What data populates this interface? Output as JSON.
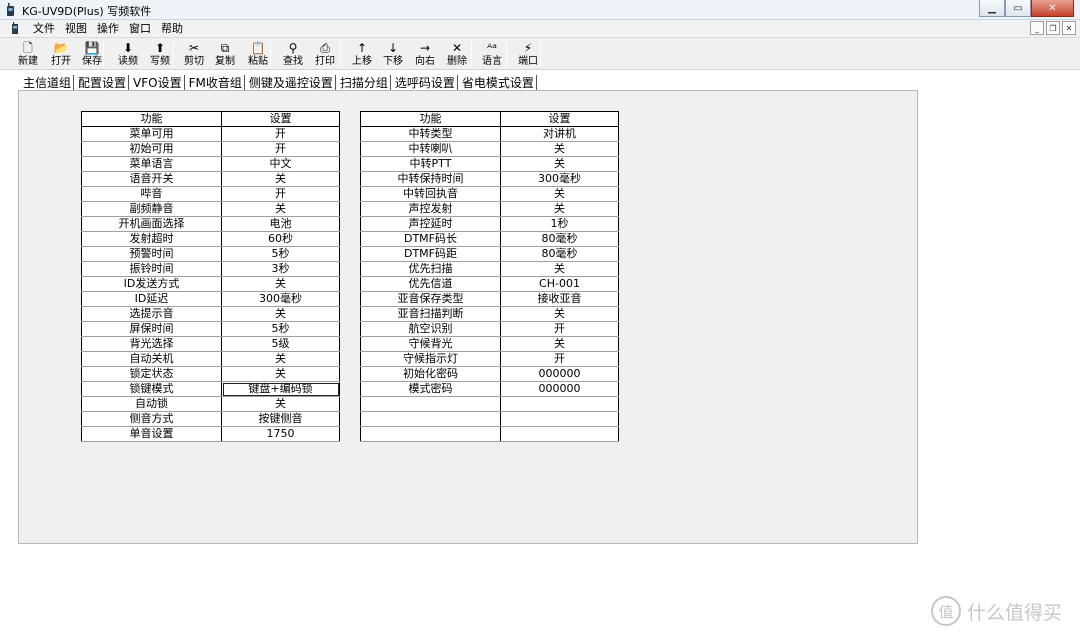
{
  "window": {
    "title": "KG-UV9D(Plus) 写频软件"
  },
  "menu": [
    "文件",
    "视图",
    "操作",
    "窗口",
    "帮助"
  ],
  "toolbar": [
    {
      "label": "新建",
      "icon": "new-file-icon",
      "glyph": "🗋"
    },
    {
      "label": "打开",
      "icon": "open-folder-icon",
      "glyph": "📂"
    },
    {
      "label": "保存",
      "icon": "save-disk-icon",
      "glyph": "💾"
    },
    {
      "label": "读频",
      "icon": "arrow-down-icon",
      "glyph": "⬇"
    },
    {
      "label": "写频",
      "icon": "arrow-up-icon",
      "glyph": "⬆"
    },
    {
      "label": "剪切",
      "icon": "scissors-icon",
      "glyph": "✂"
    },
    {
      "label": "复制",
      "icon": "copy-icon",
      "glyph": "⧉"
    },
    {
      "label": "粘贴",
      "icon": "paste-icon",
      "glyph": "📋"
    },
    {
      "label": "查找",
      "icon": "binoculars-icon",
      "glyph": "⚲"
    },
    {
      "label": "打印",
      "icon": "printer-icon",
      "glyph": "⎙"
    },
    {
      "label": "上移",
      "icon": "move-up-icon",
      "glyph": "↑"
    },
    {
      "label": "下移",
      "icon": "move-down-icon",
      "glyph": "↓"
    },
    {
      "label": "向右",
      "icon": "move-right-icon",
      "glyph": "→"
    },
    {
      "label": "删除",
      "icon": "delete-x-icon",
      "glyph": "✕"
    },
    {
      "label": "语言",
      "icon": "language-icon",
      "glyph": "ᴬᵃ"
    },
    {
      "label": "端口",
      "icon": "port-icon",
      "glyph": "⚡"
    }
  ],
  "tabs": [
    "主信道组",
    "配置设置",
    "VFO设置",
    "FM收音组",
    "侧键及遥控设置",
    "扫描分组",
    "选呼码设置",
    "省电模式设置"
  ],
  "active_tab": "配置设置",
  "table_header": {
    "function": "功能",
    "setting": "设置"
  },
  "left_table": [
    [
      "菜单可用",
      "开"
    ],
    [
      "初始可用",
      "开"
    ],
    [
      "菜单语言",
      "中文"
    ],
    [
      "语音开关",
      "关"
    ],
    [
      "哔音",
      "开"
    ],
    [
      "副频静音",
      "关"
    ],
    [
      "开机画面选择",
      "电池"
    ],
    [
      "发射超时",
      "60秒"
    ],
    [
      "预警时间",
      "5秒"
    ],
    [
      "振铃时间",
      "3秒"
    ],
    [
      "ID发送方式",
      "关"
    ],
    [
      "ID延迟",
      "300毫秒"
    ],
    [
      "选提示音",
      "关"
    ],
    [
      "屏保时间",
      "5秒"
    ],
    [
      "背光选择",
      "5级"
    ],
    [
      "自动关机",
      "关"
    ],
    [
      "锁定状态",
      "关"
    ],
    [
      "锁键模式",
      "键盘+编码锁"
    ],
    [
      "自动锁",
      "关"
    ],
    [
      "侧音方式",
      "按键侧音"
    ],
    [
      "单音设置",
      "1750"
    ]
  ],
  "right_table": [
    [
      "中转类型",
      "对讲机"
    ],
    [
      "中转喇叭",
      "关"
    ],
    [
      "中转PTT",
      "关"
    ],
    [
      "中转保持时间",
      "300毫秒"
    ],
    [
      "中转回执音",
      "关"
    ],
    [
      "声控发射",
      "关"
    ],
    [
      "声控延时",
      "1秒"
    ],
    [
      "DTMF码长",
      "80毫秒"
    ],
    [
      "DTMF码距",
      "80毫秒"
    ],
    [
      "优先扫描",
      "关"
    ],
    [
      "优先信道",
      "CH-001"
    ],
    [
      "亚音保存类型",
      "接收亚音"
    ],
    [
      "亚音扫描判断",
      "关"
    ],
    [
      "航空识别",
      "开"
    ],
    [
      "守候背光",
      "关"
    ],
    [
      "守候指示灯",
      "开"
    ],
    [
      "初始化密码",
      "000000"
    ],
    [
      "模式密码",
      "000000"
    ],
    [
      "",
      ""
    ],
    [
      "",
      ""
    ],
    [
      "",
      ""
    ]
  ],
  "watermark": {
    "text": "什么值得买",
    "glyph": "值"
  }
}
